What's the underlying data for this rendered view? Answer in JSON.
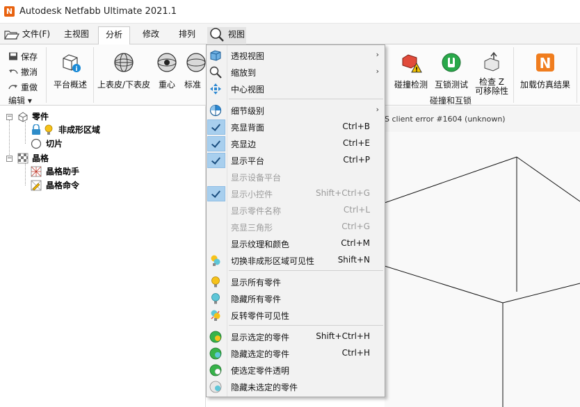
{
  "app": {
    "title": "Autodesk Netfabb Ultimate 2021.1",
    "logo_letter": "N",
    "accent": "#e8620f"
  },
  "tabs": [
    {
      "label": "文件(F)",
      "icon": "folder-open-icon"
    },
    {
      "label": "主视图"
    },
    {
      "label": "分析",
      "active": true
    },
    {
      "label": "修改"
    },
    {
      "label": "排列"
    },
    {
      "label": "视图",
      "icon": "magnifier-icon"
    }
  ],
  "ribbon": {
    "edit_group": {
      "save": "保存",
      "undo": "撤消",
      "redo": "重做",
      "label": "编辑 ▾"
    },
    "platform_overview": "平台概述",
    "upper_lower_surface": "上表皮/下表皮",
    "center_of_gravity": "重心",
    "standard_partial": "标准",
    "collision_detection": "碰撞检测",
    "interlock_test": "互锁测试",
    "check_z_removability_line1": "检查 Z",
    "check_z_removability_line2": "可移除性",
    "collision_group_label": "碰撞和互锁",
    "load_simulation_results": "加载仿真结果"
  },
  "tree": {
    "parts": "零件",
    "non_forming_region": "非成形区域",
    "slice": "切片",
    "lattice": "晶格",
    "lattice_assistant": "晶格助手",
    "lattice_command": "晶格命令"
  },
  "viewport": {
    "status": "S client error #1604 (unknown)"
  },
  "menu": {
    "items": [
      {
        "label": "透视视图",
        "shortcut": "",
        "submenu": true,
        "checked": false,
        "disabled": false,
        "icon": "perspective-cube-icon"
      },
      {
        "label": "缩放到",
        "shortcut": "",
        "submenu": true,
        "checked": false,
        "disabled": false,
        "icon": "zoom-magnifier-icon"
      },
      {
        "label": "中心视图",
        "shortcut": "",
        "submenu": false,
        "checked": false,
        "disabled": false,
        "icon": "center-arrows-icon"
      },
      {
        "label": "细节级别",
        "shortcut": "",
        "submenu": true,
        "checked": false,
        "disabled": false,
        "icon": "detail-level-icon"
      },
      {
        "label": "亮显背面",
        "shortcut": "Ctrl+B",
        "submenu": false,
        "checked": true,
        "disabled": false
      },
      {
        "label": "亮显边",
        "shortcut": "Ctrl+E",
        "submenu": false,
        "checked": true,
        "disabled": false
      },
      {
        "label": "显示平台",
        "shortcut": "Ctrl+P",
        "submenu": false,
        "checked": true,
        "disabled": false
      },
      {
        "label": "显示设备平台",
        "shortcut": "",
        "submenu": false,
        "checked": false,
        "disabled": true
      },
      {
        "label": "显示小控件",
        "shortcut": "Shift+Ctrl+G",
        "submenu": false,
        "checked": true,
        "disabled": true
      },
      {
        "label": "显示零件名称",
        "shortcut": "Ctrl+L",
        "submenu": false,
        "checked": false,
        "disabled": true
      },
      {
        "label": "亮显三角形",
        "shortcut": "Ctrl+G",
        "submenu": false,
        "checked": false,
        "disabled": true
      },
      {
        "label": "显示纹理和颜色",
        "shortcut": "Ctrl+M",
        "submenu": false,
        "checked": false,
        "disabled": false
      },
      {
        "label": "切换非成形区域可见性",
        "shortcut": "Shift+N",
        "submenu": false,
        "checked": false,
        "disabled": false,
        "icon": "toggle-visibility-bulb-icon"
      },
      {
        "label": "显示所有零件",
        "shortcut": "",
        "submenu": false,
        "checked": false,
        "disabled": false,
        "icon": "bulb-on-icon"
      },
      {
        "label": "隐藏所有零件",
        "shortcut": "",
        "submenu": false,
        "checked": false,
        "disabled": false,
        "icon": "bulb-off-icon"
      },
      {
        "label": "反转零件可见性",
        "shortcut": "",
        "submenu": false,
        "checked": false,
        "disabled": false,
        "icon": "invert-visibility-icon"
      },
      {
        "label": "显示选定的零件",
        "shortcut": "Shift+Ctrl+H",
        "submenu": false,
        "checked": false,
        "disabled": false,
        "icon": "show-selected-icon"
      },
      {
        "label": "隐藏选定的零件",
        "shortcut": "Ctrl+H",
        "submenu": false,
        "checked": false,
        "disabled": false,
        "icon": "hide-selected-icon"
      },
      {
        "label": "使选定零件透明",
        "shortcut": "",
        "submenu": false,
        "checked": false,
        "disabled": false,
        "icon": "transparent-part-icon"
      },
      {
        "label": "隐藏未选定的零件",
        "shortcut": "",
        "submenu": false,
        "checked": false,
        "disabled": false,
        "icon": "hide-unselected-icon"
      }
    ]
  }
}
